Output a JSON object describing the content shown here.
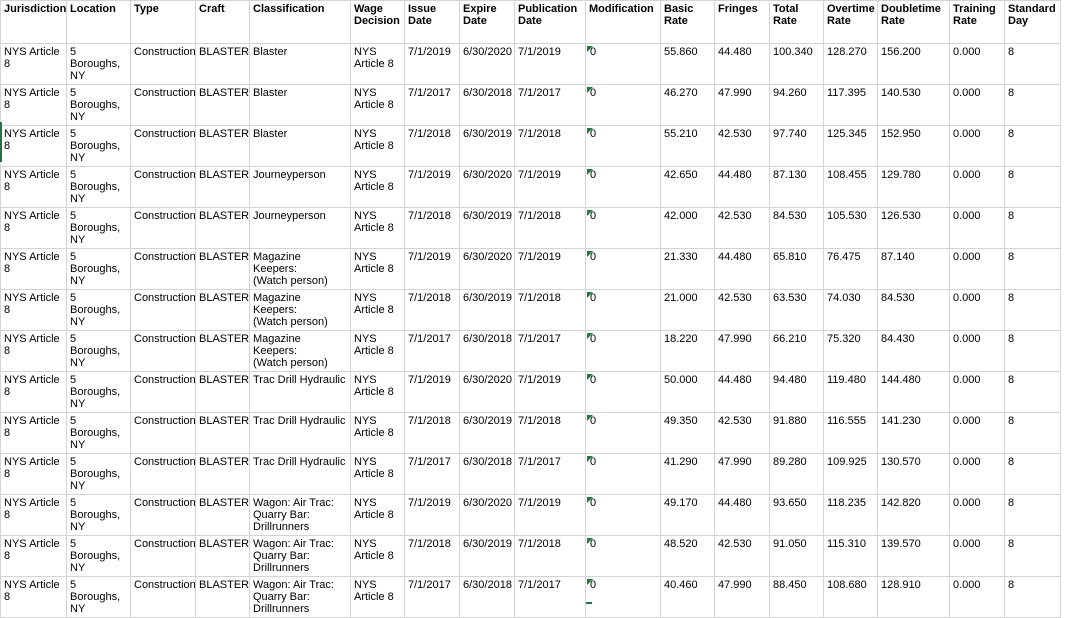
{
  "headers": [
    "Jurisdiction",
    "Location",
    "Type",
    "Craft",
    "Classification",
    "Wage\nDecision",
    "Issue\nDate",
    "Expire\nDate",
    "Publication\nDate",
    "Modification",
    "Basic\nRate",
    "Fringes",
    "Total Rate",
    "Overtime\nRate",
    "Doubletime\nRate",
    "Training\nRate",
    "Standard\nDay"
  ],
  "rows": [
    [
      "NYS Article 8",
      "5 Boroughs,\nNY",
      "Construction",
      "BLASTER",
      "Blaster",
      "NYS\nArticle 8",
      "7/1/2019",
      "6/30/2020",
      "7/1/2019",
      "0",
      "55.860",
      "44.480",
      "100.340",
      "128.270",
      "156.200",
      "0.000",
      "8"
    ],
    [
      "NYS Article 8",
      "5 Boroughs,\nNY",
      "Construction",
      "BLASTER",
      "Blaster",
      "NYS\nArticle 8",
      "7/1/2017",
      "6/30/2018",
      "7/1/2017",
      "0",
      "46.270",
      "47.990",
      "94.260",
      "117.395",
      "140.530",
      "0.000",
      "8"
    ],
    [
      "NYS Article 8",
      "5 Boroughs,\nNY",
      "Construction",
      "BLASTER",
      "Blaster",
      "NYS\nArticle 8",
      "7/1/2018",
      "6/30/2019",
      "7/1/2018",
      "0",
      "55.210",
      "42.530",
      "97.740",
      "125.345",
      "152.950",
      "0.000",
      "8"
    ],
    [
      "NYS Article 8",
      "5 Boroughs,\nNY",
      "Construction",
      "BLASTER",
      "Journeyperson",
      "NYS\nArticle 8",
      "7/1/2019",
      "6/30/2020",
      "7/1/2019",
      "0",
      "42.650",
      "44.480",
      "87.130",
      "108.455",
      "129.780",
      "0.000",
      "8"
    ],
    [
      "NYS Article 8",
      "5 Boroughs,\nNY",
      "Construction",
      "BLASTER",
      "Journeyperson",
      "NYS\nArticle 8",
      "7/1/2018",
      "6/30/2019",
      "7/1/2018",
      "0",
      "42.000",
      "42.530",
      "84.530",
      "105.530",
      "126.530",
      "0.000",
      "8"
    ],
    [
      "NYS Article 8",
      "5 Boroughs,\nNY",
      "Construction",
      "BLASTER",
      "Magazine Keepers:\n(Watch person)",
      "NYS\nArticle 8",
      "7/1/2019",
      "6/30/2020",
      "7/1/2019",
      "0",
      "21.330",
      "44.480",
      "65.810",
      "76.475",
      "87.140",
      "0.000",
      "8"
    ],
    [
      "NYS Article 8",
      "5 Boroughs,\nNY",
      "Construction",
      "BLASTER",
      "Magazine Keepers:\n(Watch person)",
      "NYS\nArticle 8",
      "7/1/2018",
      "6/30/2019",
      "7/1/2018",
      "0",
      "21.000",
      "42.530",
      "63.530",
      "74.030",
      "84.530",
      "0.000",
      "8"
    ],
    [
      "NYS Article 8",
      "5 Boroughs,\nNY",
      "Construction",
      "BLASTER",
      "Magazine Keepers:\n(Watch person)",
      "NYS\nArticle 8",
      "7/1/2017",
      "6/30/2018",
      "7/1/2017",
      "0",
      "18.220",
      "47.990",
      "66.210",
      "75.320",
      "84.430",
      "0.000",
      "8"
    ],
    [
      "NYS Article 8",
      "5 Boroughs,\nNY",
      "Construction",
      "BLASTER",
      "Trac Drill Hydraulic",
      "NYS\nArticle 8",
      "7/1/2019",
      "6/30/2020",
      "7/1/2019",
      "0",
      "50.000",
      "44.480",
      "94.480",
      "119.480",
      "144.480",
      "0.000",
      "8"
    ],
    [
      "NYS Article 8",
      "5 Boroughs,\nNY",
      "Construction",
      "BLASTER",
      "Trac Drill Hydraulic",
      "NYS\nArticle 8",
      "7/1/2018",
      "6/30/2019",
      "7/1/2018",
      "0",
      "49.350",
      "42.530",
      "91.880",
      "116.555",
      "141.230",
      "0.000",
      "8"
    ],
    [
      "NYS Article 8",
      "5 Boroughs,\nNY",
      "Construction",
      "BLASTER",
      "Trac Drill Hydraulic",
      "NYS\nArticle 8",
      "7/1/2017",
      "6/30/2018",
      "7/1/2017",
      "0",
      "41.290",
      "47.990",
      "89.280",
      "109.925",
      "130.570",
      "0.000",
      "8"
    ],
    [
      "NYS Article 8",
      "5 Boroughs,\nNY",
      "Construction",
      "BLASTER",
      "Wagon: Air Trac:\nQuarry Bar:\nDrillrunners",
      "NYS\nArticle 8",
      "7/1/2019",
      "6/30/2020",
      "7/1/2019",
      "0",
      "49.170",
      "44.480",
      "93.650",
      "118.235",
      "142.820",
      "0.000",
      "8"
    ],
    [
      "NYS Article 8",
      "5 Boroughs,\nNY",
      "Construction",
      "BLASTER",
      "Wagon: Air Trac:\nQuarry Bar:\nDrillrunners",
      "NYS\nArticle 8",
      "7/1/2018",
      "6/30/2019",
      "7/1/2018",
      "0",
      "48.520",
      "42.530",
      "91.050",
      "115.310",
      "139.570",
      "0.000",
      "8"
    ],
    [
      "NYS Article 8",
      "5 Boroughs,\nNY",
      "Construction",
      "BLASTER",
      "Wagon: Air Trac:\nQuarry Bar:\nDrillrunners",
      "NYS\nArticle 8",
      "7/1/2017",
      "6/30/2018",
      "7/1/2017",
      "0",
      "40.460",
      "47.990",
      "88.450",
      "108.680",
      "128.910",
      "0.000",
      "8"
    ]
  ],
  "colors": {
    "grid": "#d4d4d4",
    "selection": "#217346",
    "error_indicator": "#1f7a3a"
  },
  "icons": {
    "modification_cell_marker": "number-stored-as-text-indicator-icon"
  }
}
